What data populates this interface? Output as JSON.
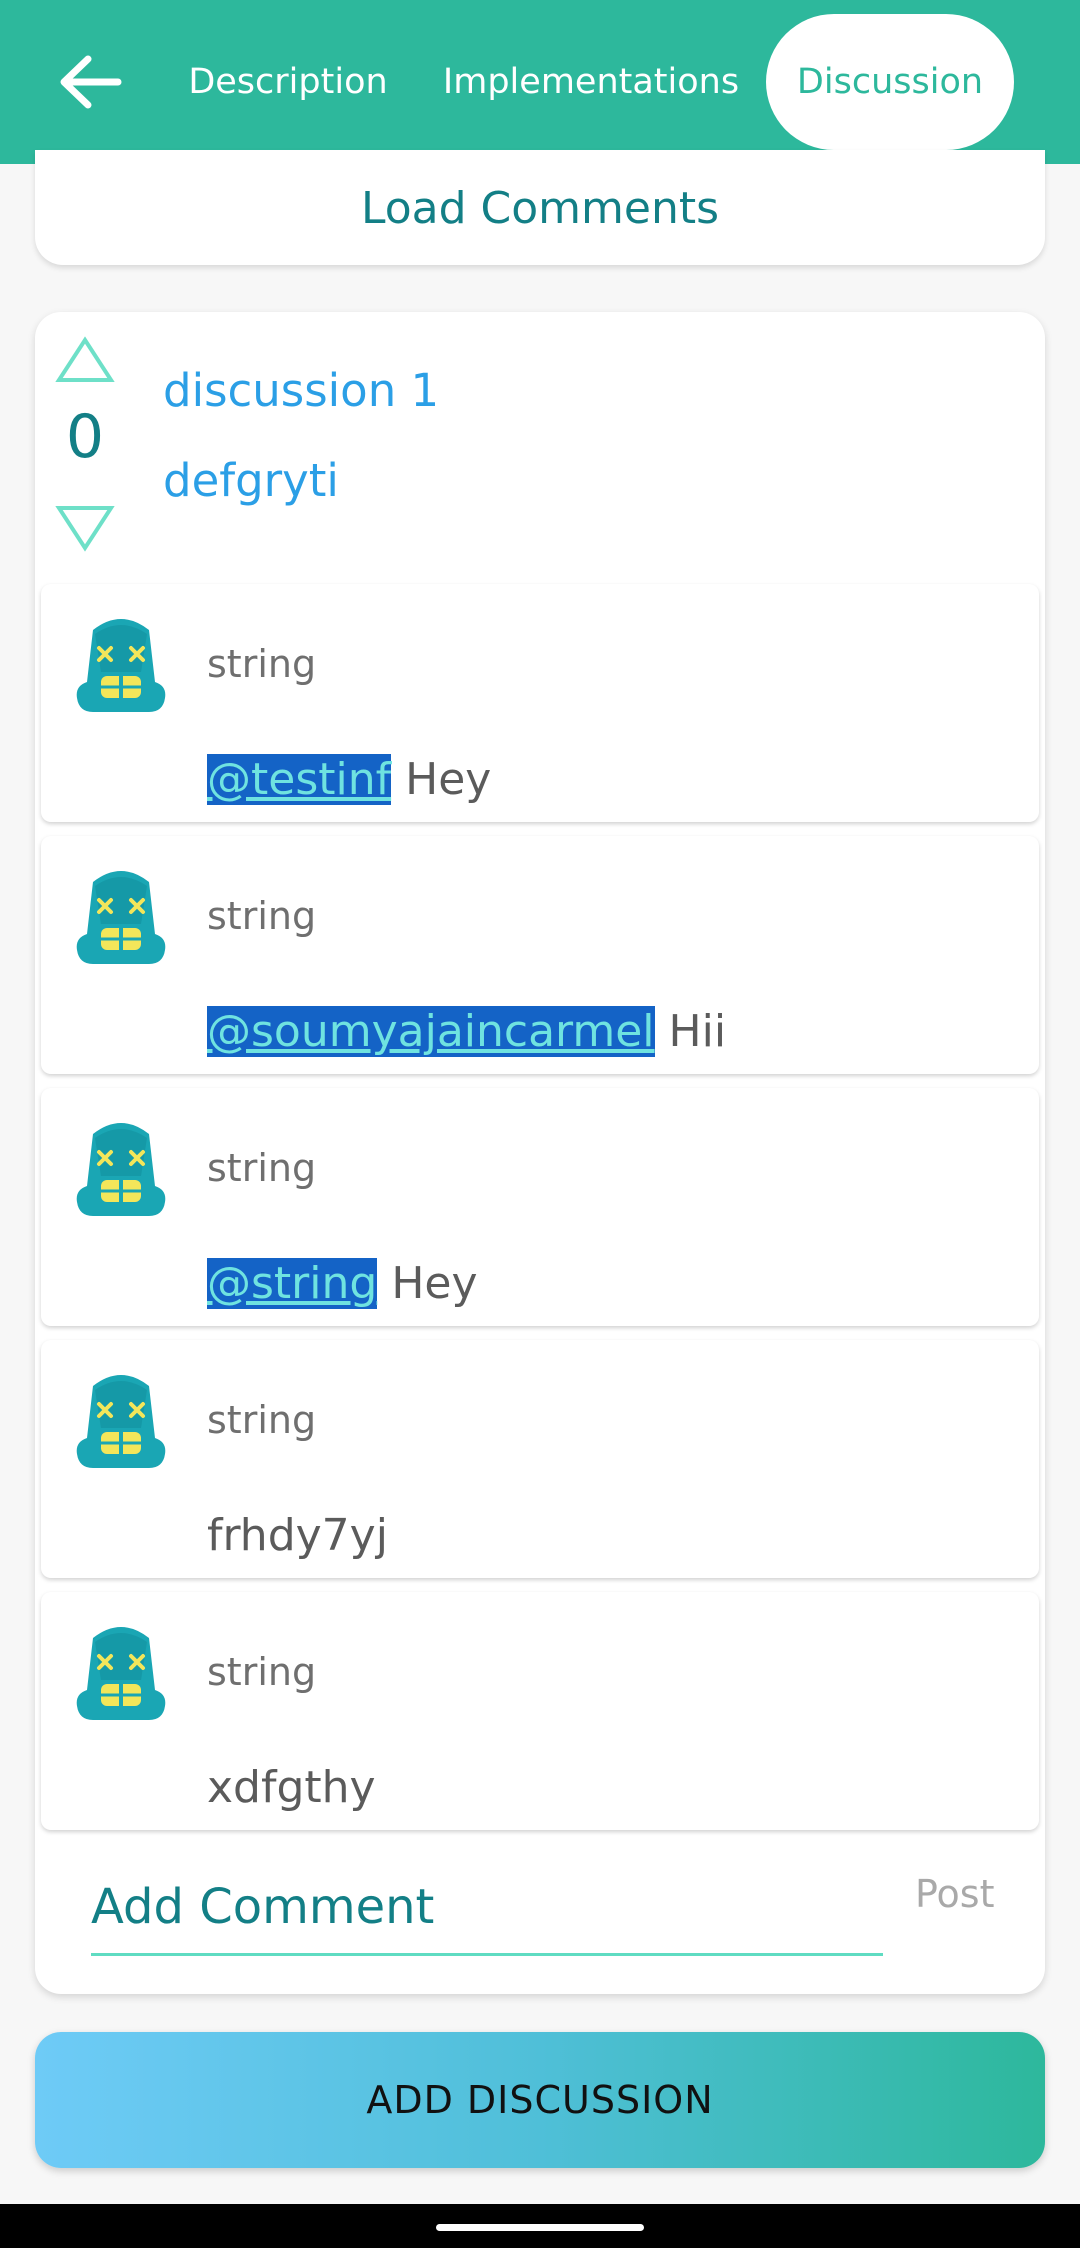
{
  "header": {
    "back_icon": "arrow-left-icon",
    "tabs": [
      {
        "label": "Description"
      },
      {
        "label": "Implementations"
      },
      {
        "label": "Discussion",
        "selected": true
      }
    ]
  },
  "load_comments_label": "Load Comments",
  "discussion": {
    "votes": "0",
    "title": "discussion 1",
    "body": "defgryti",
    "comments": [
      {
        "author": "string",
        "mention": "@testinf",
        "text": "Hey"
      },
      {
        "author": "string",
        "mention": "@soumyajaincarmel",
        "text": "Hii"
      },
      {
        "author": "string",
        "mention": "@string",
        "text": "Hey"
      },
      {
        "author": "string",
        "mention": "",
        "text": "frhdy7yj"
      },
      {
        "author": "string",
        "mention": "",
        "text": "xdfgthy"
      }
    ],
    "comment_placeholder": "Add Comment",
    "post_label": "Post"
  },
  "add_discussion_label": "ADD DISCUSSION",
  "colors": {
    "primary": "#2db89c",
    "accent_text": "#137f86",
    "link": "#2b9fe6",
    "mention_bg": "#1463c6"
  }
}
